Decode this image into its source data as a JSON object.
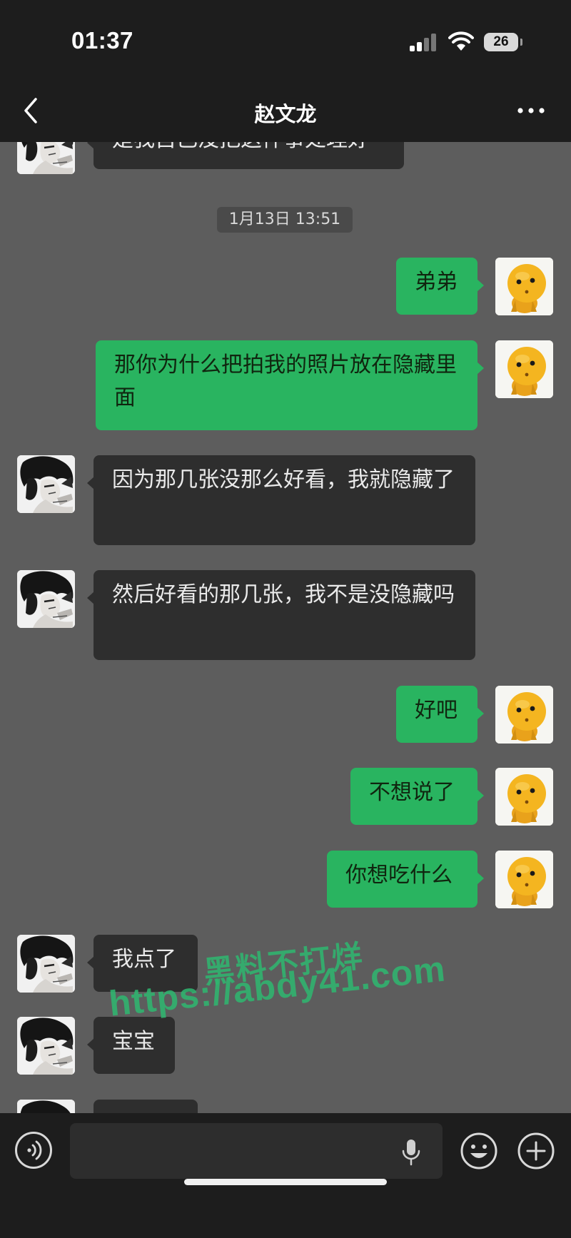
{
  "status_bar": {
    "time": "01:37",
    "battery": "26"
  },
  "header": {
    "title": "赵文龙"
  },
  "chat": {
    "timestamp": "1月13日 13:51",
    "messages": [
      {
        "from": "contact",
        "text": "是我自己没把这件事处理好"
      },
      {
        "from": "me",
        "text": "弟弟"
      },
      {
        "from": "me",
        "text": "那你为什么把拍我的照片放在隐藏里面"
      },
      {
        "from": "contact",
        "text": "因为那几张没那么好看，我就隐藏了"
      },
      {
        "from": "contact",
        "text": "然后好看的那几张，我不是没隐藏吗"
      },
      {
        "from": "me",
        "text": "好吧"
      },
      {
        "from": "me",
        "text": "不想说了"
      },
      {
        "from": "me",
        "text": "你想吃什么"
      },
      {
        "from": "contact",
        "text": "我点了"
      },
      {
        "from": "contact",
        "text": "宝宝"
      }
    ]
  },
  "watermark": {
    "line1": "黑料不打烊",
    "line2": "https://abdy41.com"
  },
  "input_bar": {
    "placeholder": ""
  },
  "icons": {
    "back": "chevron-left-icon",
    "more": "more-dots-icon",
    "voice": "voice-icon",
    "mic": "mic-icon",
    "emoji": "emoji-icon",
    "add": "plus-icon"
  },
  "colors": {
    "chat_background": "#5d5d5d",
    "bar_background": "#1d1d1d",
    "outgoing_bubble": "#29b460",
    "incoming_bubble": "#2e2e2e",
    "watermark": "#2fb870"
  }
}
